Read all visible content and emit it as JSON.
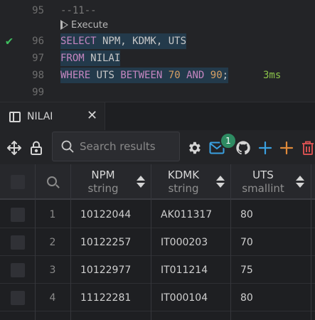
{
  "editor": {
    "lines": [
      {
        "num": "95",
        "tokens": [
          {
            "t": "--11--",
            "c": "cm"
          }
        ]
      },
      {
        "num": "96",
        "tokens": [
          {
            "t": "SELECT",
            "c": "kw"
          },
          {
            "t": " NPM, KDMK, UTS",
            "c": "id"
          }
        ]
      },
      {
        "num": "97",
        "tokens": [
          {
            "t": "FROM",
            "c": "kw"
          },
          {
            "t": " NILAI",
            "c": "id"
          }
        ]
      },
      {
        "num": "98",
        "tokens": [
          {
            "t": "WHERE",
            "c": "kw"
          },
          {
            "t": " UTS ",
            "c": "id"
          },
          {
            "t": "BETWEEN",
            "c": "kw"
          },
          {
            "t": " ",
            "c": "id"
          },
          {
            "t": "70",
            "c": "num"
          },
          {
            "t": " ",
            "c": "id"
          },
          {
            "t": "AND",
            "c": "kw"
          },
          {
            "t": " ",
            "c": "id"
          },
          {
            "t": "90",
            "c": "num"
          },
          {
            "t": ";",
            "c": "id"
          }
        ]
      },
      {
        "num": "99",
        "tokens": []
      }
    ],
    "codelens_label": "Execute",
    "timing": "3ms",
    "success_mark": "✔"
  },
  "tab": {
    "label": "NILAI",
    "close": "✕"
  },
  "toolbar": {
    "search_placeholder": "Search results",
    "badge_count": "1",
    "icons": [
      "move-icon",
      "lock-icon",
      "gear-icon",
      "mail-icon",
      "github-icon",
      "add-row-icon",
      "add-column-icon",
      "delete-icon"
    ]
  },
  "grid": {
    "columns": [
      {
        "name": "NPM",
        "type": "string"
      },
      {
        "name": "KDMK",
        "type": "string"
      },
      {
        "name": "UTS",
        "type": "smallint"
      }
    ],
    "rows": [
      {
        "n": "1",
        "cells": [
          "10122044",
          "AK011317",
          "80"
        ]
      },
      {
        "n": "2",
        "cells": [
          "10122257",
          "IT000203",
          "70"
        ]
      },
      {
        "n": "3",
        "cells": [
          "10122977",
          "IT011214",
          "75"
        ]
      },
      {
        "n": "4",
        "cells": [
          "11122281",
          "IT000104",
          "80"
        ]
      }
    ]
  },
  "colors": {
    "accent_blue": "#3aa0e0",
    "accent_orange": "#e08a3a",
    "delete_red": "#d45050",
    "badge_green": "#2e8b62"
  }
}
